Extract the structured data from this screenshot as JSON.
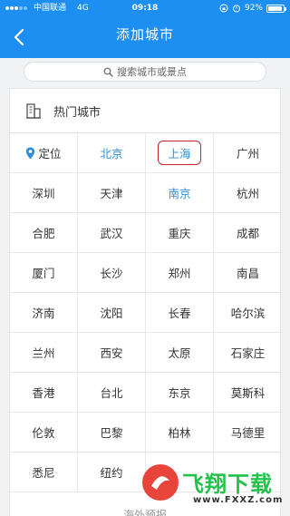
{
  "status_bar": {
    "carrier": "中国联通",
    "network": "4G",
    "time": "09:18",
    "battery": "92%",
    "battery_level": 0.92
  },
  "header": {
    "title": "添加城市",
    "accent_color": "#1e8ff2"
  },
  "search": {
    "placeholder": "搜索城市或景点"
  },
  "hot_cities": {
    "title": "热门城市",
    "locate_label": "定位",
    "rows": [
      [
        "北京",
        "上海",
        "广州"
      ],
      [
        "深圳",
        "天津",
        "南京",
        "杭州"
      ],
      [
        "合肥",
        "武汉",
        "重庆",
        "成都"
      ],
      [
        "厦门",
        "长沙",
        "郑州",
        "南昌"
      ],
      [
        "济南",
        "沈阳",
        "长春",
        "哈尔滨"
      ],
      [
        "兰州",
        "西安",
        "太原",
        "石家庄"
      ],
      [
        "香港",
        "台北",
        "东京",
        "莫斯科"
      ],
      [
        "伦敦",
        "巴黎",
        "柏林",
        "马德里"
      ],
      [
        "悉尼",
        "纽约"
      ]
    ],
    "selected_city": "上海",
    "highlight_color": "#2f8fd8",
    "selection_border_color": "#c4282e"
  },
  "more_section_label": "海外预报",
  "watermark": {
    "text": "飞翔下载",
    "url": "www.FXXZ.com"
  }
}
